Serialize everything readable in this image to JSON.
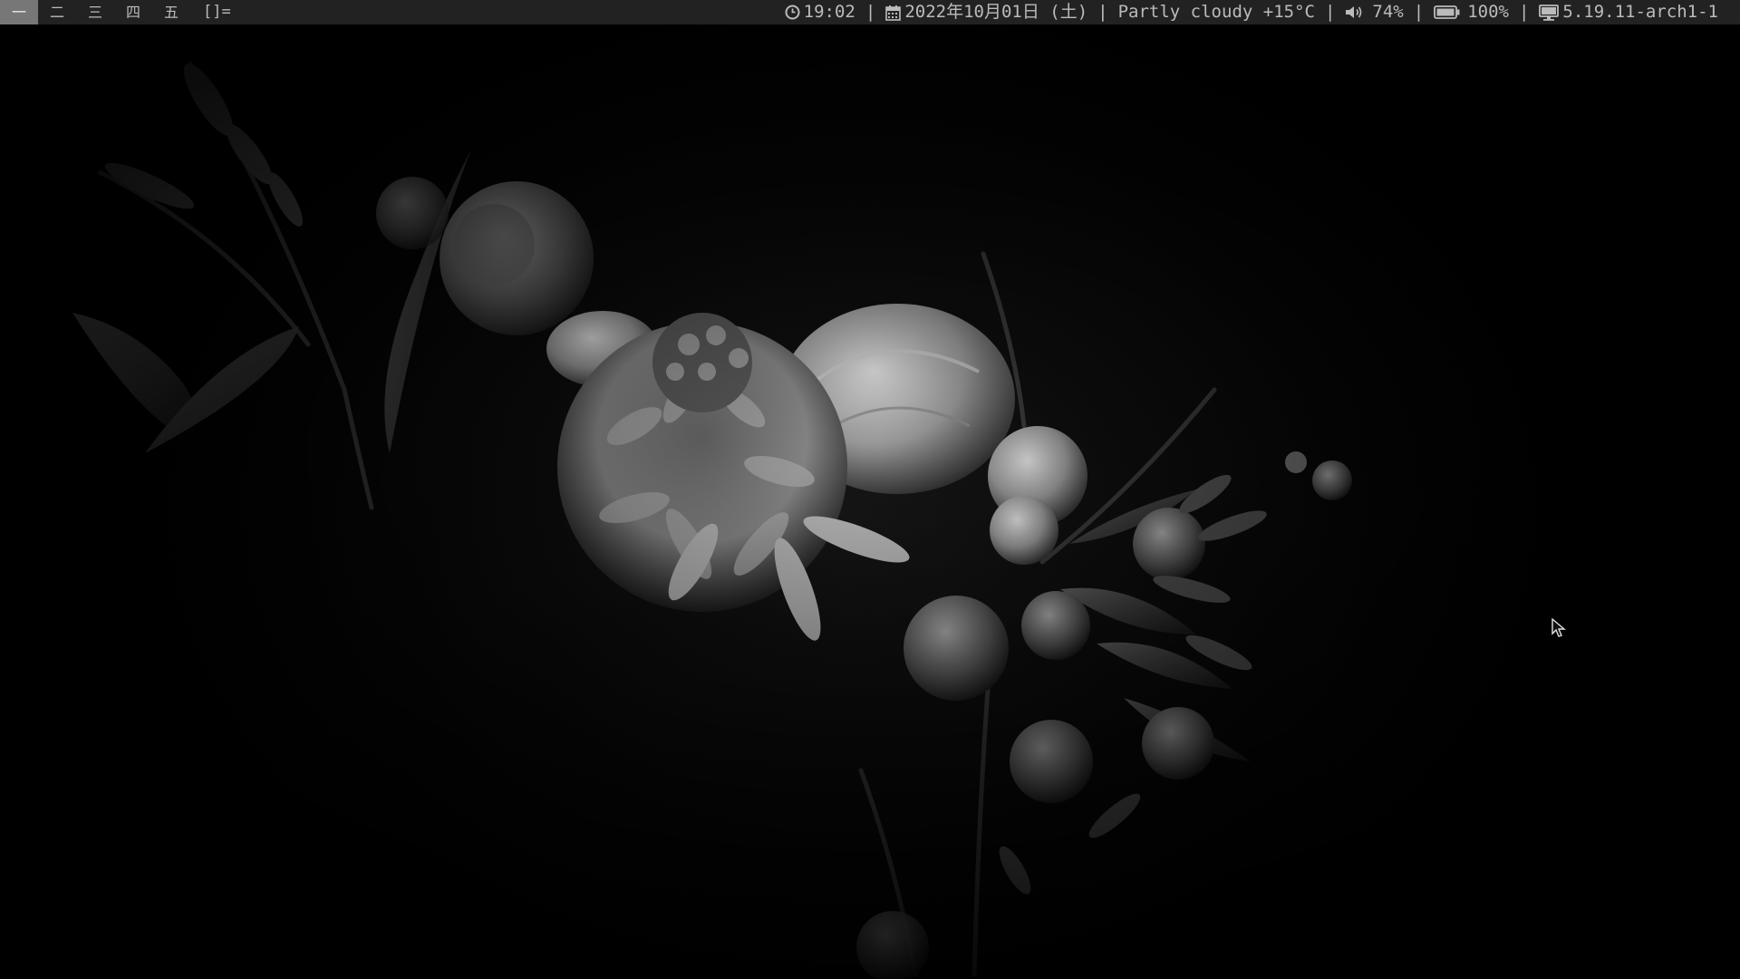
{
  "bar": {
    "tags": [
      {
        "label": "一",
        "selected": true
      },
      {
        "label": "二",
        "selected": false
      },
      {
        "label": "三",
        "selected": false
      },
      {
        "label": "四",
        "selected": false
      },
      {
        "label": "五",
        "selected": false
      }
    ],
    "layout_symbol": "[]=",
    "status": {
      "time": "19:02",
      "date": "2022年10月01日 (土)",
      "weather": "Partly cloudy +15°C",
      "volume": "74%",
      "battery": "100%",
      "kernel": "5.19.11-arch1-1",
      "separator": "|"
    },
    "icons": {
      "time": "clock-icon",
      "date": "calendar-icon",
      "volume": "speaker-icon",
      "battery": "battery-icon",
      "kernel": "monitor-icon"
    }
  },
  "wallpaper": {
    "subject": "monochrome flower bouquet",
    "tone": "black-and-white"
  },
  "colors": {
    "bar_bg": "#222222",
    "bar_fg": "#bbbbbb",
    "tag_selected_bg": "#777777",
    "background": "#000000"
  }
}
